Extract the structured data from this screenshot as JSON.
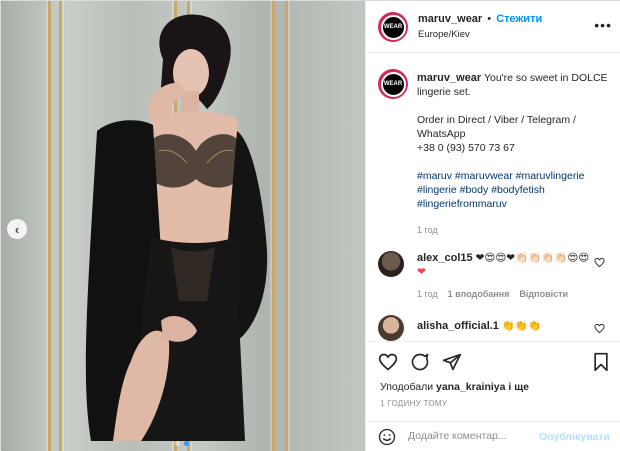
{
  "post": {
    "username": "maruv_wear",
    "follow_separator": "•",
    "follow_label": "Стежити",
    "location": "Europe/Kiev",
    "avatar_text": "WEAR",
    "more_label": "•••"
  },
  "caption": {
    "username": "maruv_wear",
    "text_line1": "You're so sweet in DOLCE lingerie set.",
    "order_line": "Order in Direct / Viber / Telegram / WhatsApp",
    "phone": "+38 0 (93) 570 73 67",
    "hashtags": "#maruv #maruvwear #maruvlingerie #lingerie #body #bodyfetish #lingeriefrommaruv",
    "time": "1 год"
  },
  "comments": [
    {
      "username": "alex_col15",
      "text": "❤😍😍❤👏🏻👏🏻👏🏻👏🏻😍😍",
      "text2": "❤",
      "time": "1 год",
      "replies": "1 вподобання",
      "reply_label": "Відповісти"
    },
    {
      "username": "alisha_official.1",
      "text": "👏👏👏"
    }
  ],
  "likes": {
    "prefix": "Уподобали",
    "user": "yana_krainiya",
    "suffix": "і ще"
  },
  "posted_ago": "1 ГОДИНУ ТОМУ",
  "add_comment": {
    "placeholder": "Додайте коментар...",
    "publish_label": "Опублікувати"
  },
  "carousel": {
    "total": 2,
    "active_index": 1
  },
  "colors": {
    "accent": "#0095f6",
    "publish_disabled": "#b2dffc",
    "hashtag": "#00376b",
    "heart_red": "#ed4956"
  }
}
